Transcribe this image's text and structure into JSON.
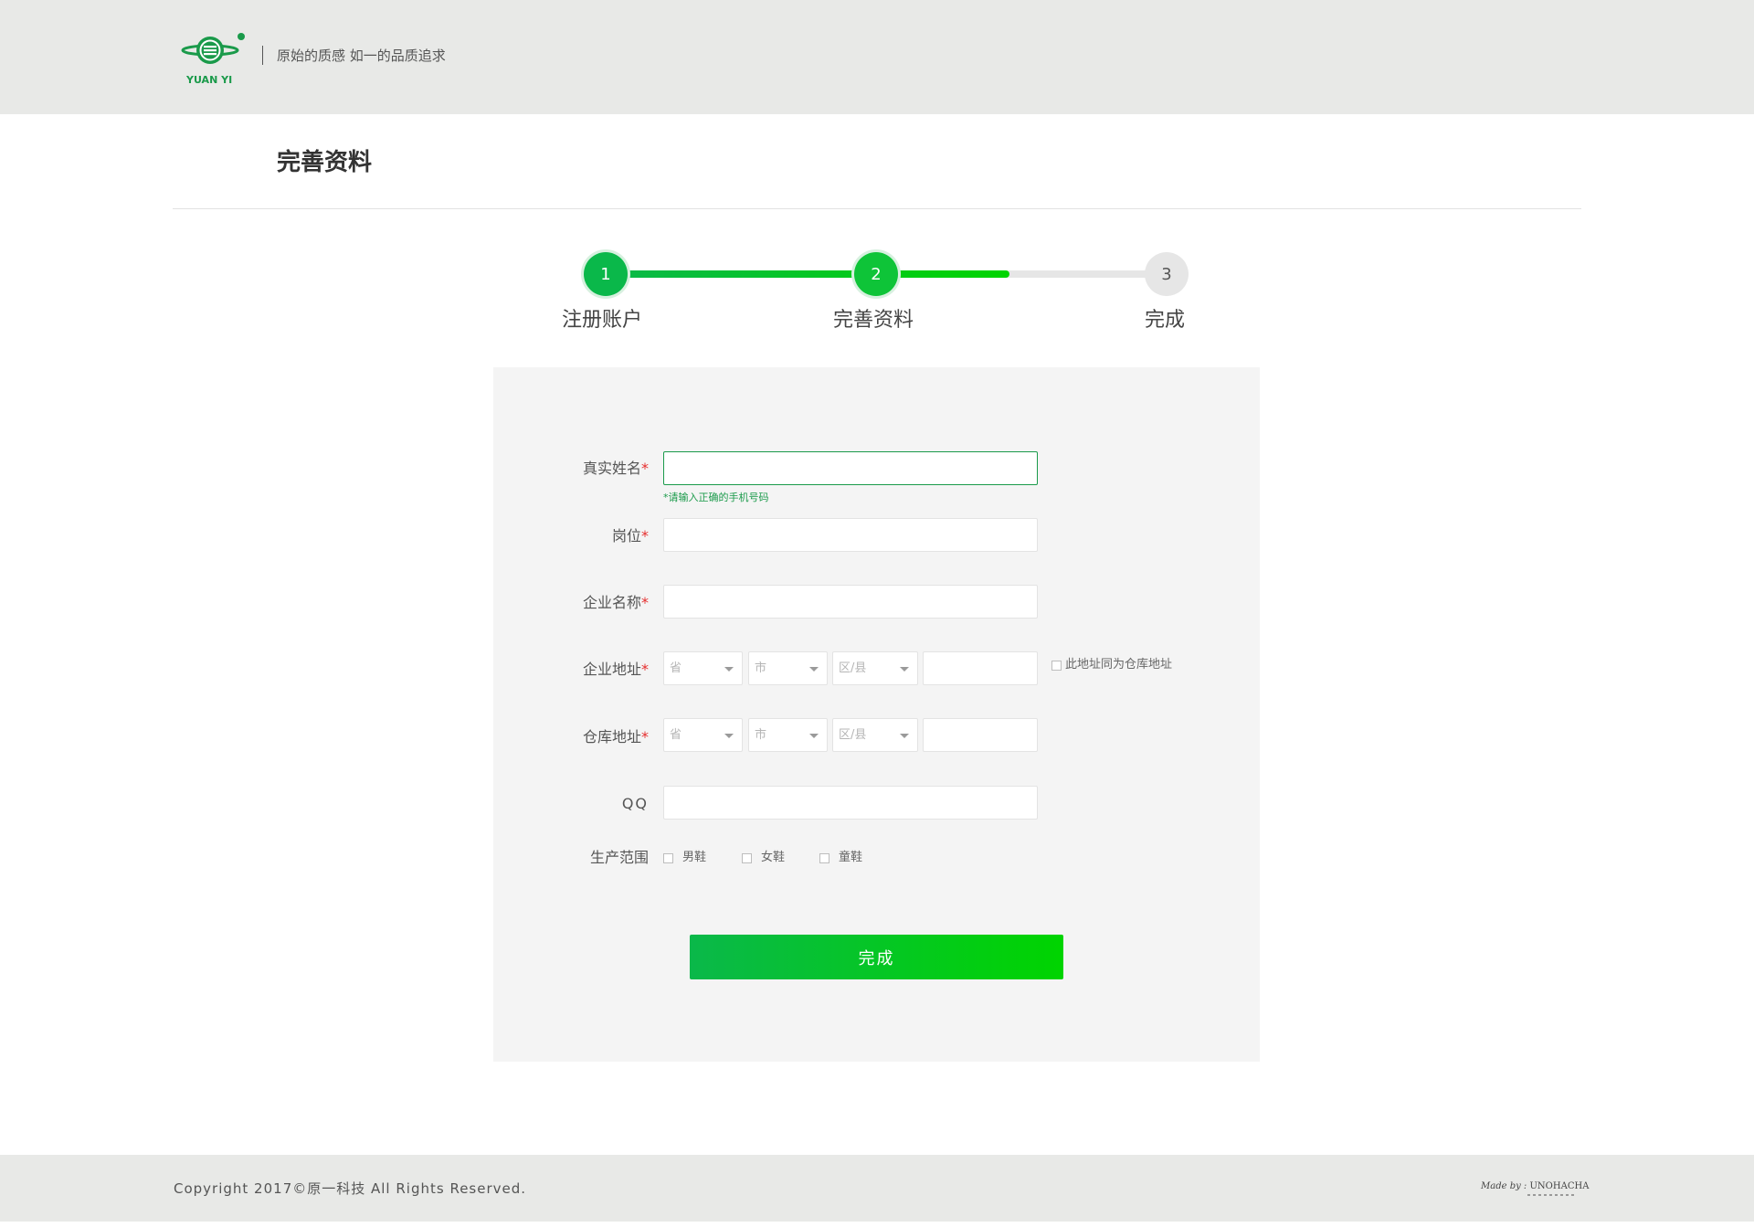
{
  "header": {
    "logo_text": "YUAN YI",
    "slogan": "原始的质感 如一的品质追求"
  },
  "page": {
    "title": "完善资料"
  },
  "steps": [
    {
      "number": "1",
      "label": "注册账户"
    },
    {
      "number": "2",
      "label": "完善资料"
    },
    {
      "number": "3",
      "label": "完成"
    }
  ],
  "progress": {
    "completed_steps": 2,
    "total_steps": 3,
    "fill_fraction": 0.72
  },
  "form": {
    "required_mark": "*",
    "real_name": {
      "label": "真实姓名",
      "value": "",
      "hint": "*请输入正确的手机号码"
    },
    "position": {
      "label": "岗位",
      "value": ""
    },
    "company_name": {
      "label": "企业名称",
      "value": ""
    },
    "company_address": {
      "label": "企业地址",
      "province": "省",
      "city": "市",
      "district": "区/县",
      "detail": "",
      "same_as_warehouse_label": "此地址同为仓库地址"
    },
    "warehouse_address": {
      "label": "仓库地址",
      "province": "省",
      "city": "市",
      "district": "区/县",
      "detail": ""
    },
    "qq": {
      "label": "QQ",
      "value": ""
    },
    "production_scope": {
      "label": "生产范围",
      "options": [
        "男鞋",
        "女鞋",
        "童鞋"
      ]
    },
    "submit_label": "完成"
  },
  "footer": {
    "copyright": "Copyright 2017©原一科技 All Rights Reserved.",
    "made_by_prefix": "Made by :",
    "made_by_name": "UNOHACHA"
  },
  "colors": {
    "brand_green": "#0ab84a",
    "bright_green": "#00d400",
    "required_red": "#e62e2e",
    "header_bg": "#e8e9e7",
    "panel_bg": "#f4f4f4"
  }
}
